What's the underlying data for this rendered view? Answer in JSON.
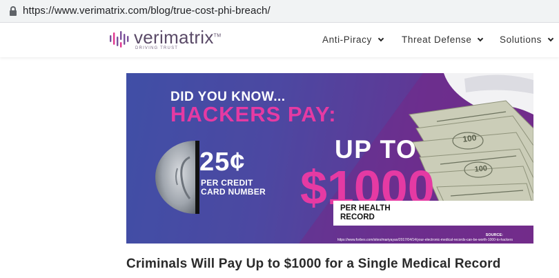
{
  "browser": {
    "url": "https://www.verimatrix.com/blog/true-cost-phi-breach/"
  },
  "brand": {
    "name": "verimatrix",
    "tm": "TM",
    "tagline": "DRIVING TRUST",
    "color": "#5a4a67"
  },
  "nav": [
    {
      "label": "Anti-Piracy"
    },
    {
      "label": "Threat Defense"
    },
    {
      "label": "Solutions"
    }
  ],
  "hero": {
    "did_you_know": "DID YOU KNOW...",
    "hackers_pay": "HACKERS PAY:",
    "coin_price": "25¢",
    "coin_caption_1": "PER CREDIT",
    "coin_caption_2": "CARD NUMBER",
    "up_to": "UP TO",
    "amount": "$1000",
    "health_caption_1": "PER HEALTH",
    "health_caption_2": "RECORD",
    "source_label": "SOURCE:",
    "source_url": "https://www.forbes.com/sites/mariyayao/2017/04/14/your-electronic-medical-records-can-be-worth-1000-to-hackers",
    "accent_color": "#e53aa3"
  },
  "article": {
    "title": "Criminals Will Pay Up to $1000 for a Single Medical Record"
  }
}
